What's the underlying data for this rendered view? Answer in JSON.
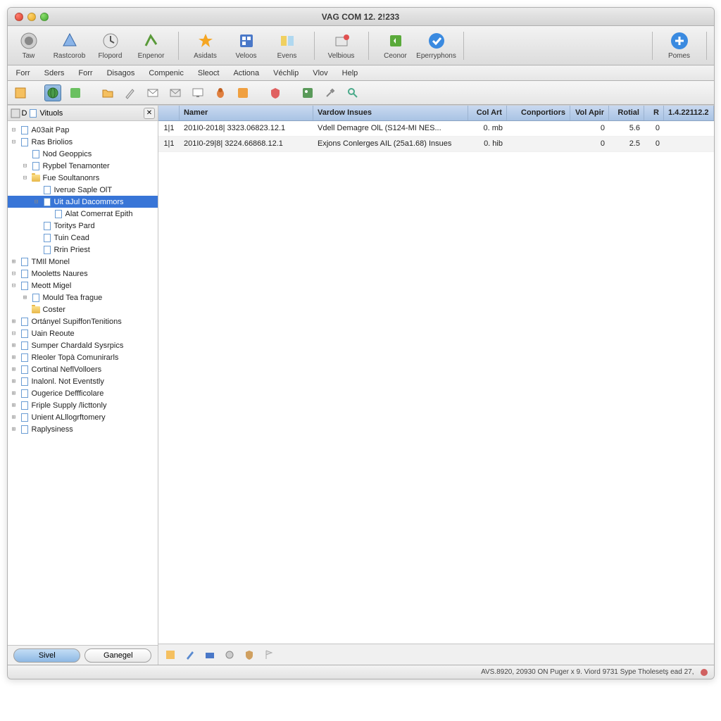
{
  "window_title": "VAG COM 12. 2!233",
  "toolbar1": [
    {
      "label": "Taw"
    },
    {
      "label": "Rastcorob"
    },
    {
      "label": "Flopord"
    },
    {
      "label": "Enpenor"
    },
    {
      "label": "Asidats"
    },
    {
      "label": "Veloos"
    },
    {
      "label": "Evens"
    },
    {
      "label": "Velbious"
    },
    {
      "label": "Ceonor"
    },
    {
      "label": "Eperryphons"
    },
    {
      "label": "Pomes"
    }
  ],
  "menu": [
    "Forr",
    "Sders",
    "Forr",
    "Disagos",
    "Compenic",
    "Sleoct",
    "Actiona",
    "Véchlip",
    "Vlov",
    "Help"
  ],
  "sidebar_title": "Vituols",
  "tree": [
    {
      "d": 0,
      "exp": "-",
      "t": "A03ait Pap",
      "ico": "page"
    },
    {
      "d": 0,
      "exp": "-",
      "t": "Ras Briolios",
      "ico": "page"
    },
    {
      "d": 1,
      "exp": "",
      "t": "Nod Geoppics",
      "ico": "page"
    },
    {
      "d": 1,
      "exp": "-",
      "t": "Rypbel Tenamonter",
      "ico": "page"
    },
    {
      "d": 1,
      "exp": "-",
      "t": "Fue Soultanonrs",
      "ico": "folder"
    },
    {
      "d": 2,
      "exp": "",
      "t": "Iverue Saple OlT",
      "ico": "page"
    },
    {
      "d": 2,
      "exp": "-",
      "t": "Uit aJul Dacommors",
      "ico": "page",
      "sel": true
    },
    {
      "d": 3,
      "exp": "",
      "t": "Alat Comerrat Epith",
      "ico": "page"
    },
    {
      "d": 2,
      "exp": "",
      "t": "Toritys Pard",
      "ico": "page"
    },
    {
      "d": 2,
      "exp": "",
      "t": "Tuin Cead",
      "ico": "page"
    },
    {
      "d": 2,
      "exp": "",
      "t": "Rrin Priest",
      "ico": "page"
    },
    {
      "d": 0,
      "exp": "+",
      "t": "TMIl Monel",
      "ico": "page"
    },
    {
      "d": 0,
      "exp": "-",
      "t": "Mooletts Naures",
      "ico": "page"
    },
    {
      "d": 0,
      "exp": "-",
      "t": "Meott Migel",
      "ico": "page"
    },
    {
      "d": 1,
      "exp": "+",
      "t": "Mould Tea frague",
      "ico": "page"
    },
    {
      "d": 1,
      "exp": "",
      "t": "Coster",
      "ico": "folder"
    },
    {
      "d": 0,
      "exp": "+",
      "t": "Ortányel SupiffonTenitions",
      "ico": "page"
    },
    {
      "d": 0,
      "exp": "-",
      "t": "Uain Reoute",
      "ico": "page"
    },
    {
      "d": 0,
      "exp": "+",
      "t": "Sumper Chardald Sysrpics",
      "ico": "page"
    },
    {
      "d": 0,
      "exp": "+",
      "t": "Rleoler Topà Comunirarls",
      "ico": "page"
    },
    {
      "d": 0,
      "exp": "+",
      "t": "Cortinal NeflVolloers",
      "ico": "page"
    },
    {
      "d": 0,
      "exp": "+",
      "t": "Inalonl. Not Eventstly",
      "ico": "page"
    },
    {
      "d": 0,
      "exp": "+",
      "t": "Ougerice Deffficolare",
      "ico": "page"
    },
    {
      "d": 0,
      "exp": "+",
      "t": "Friple Supply /licttonly",
      "ico": "page"
    },
    {
      "d": 0,
      "exp": "+",
      "t": "Unient ALllogrftomery",
      "ico": "page"
    },
    {
      "d": 0,
      "exp": "+",
      "t": "Raplysiness",
      "ico": "page"
    }
  ],
  "side_buttons": {
    "save": "Sivel",
    "cancel": "Ganegel"
  },
  "columns": [
    "Namer",
    "Vardow Insues",
    "Col Art",
    "Conportiors",
    "Vol Apir",
    "Rotial",
    "R",
    "1.4.22112.2"
  ],
  "rows": [
    {
      "idx": "1|1",
      "name": "201I0-2018| 3323.06823.12.1",
      "vardow": "Vdell Demagre OlL (S124-MI NES...",
      "art": "0. mb",
      "conp": "",
      "valap": "0",
      "rotal": "5.6",
      "r": "0",
      "last": ""
    },
    {
      "idx": "1|1",
      "name": "201I0-29|8| 3224.66868.12.1",
      "vardow": "Exjons Conlerges AIL (25a1.68) Insues",
      "art": "0. hib",
      "conp": "",
      "valap": "0",
      "rotal": "2.5",
      "r": "0",
      "last": ""
    }
  ],
  "status": "AVS.8920, 20930 ON Puger x 9. Viord 9731   Sype Tholesetş ead  27,"
}
